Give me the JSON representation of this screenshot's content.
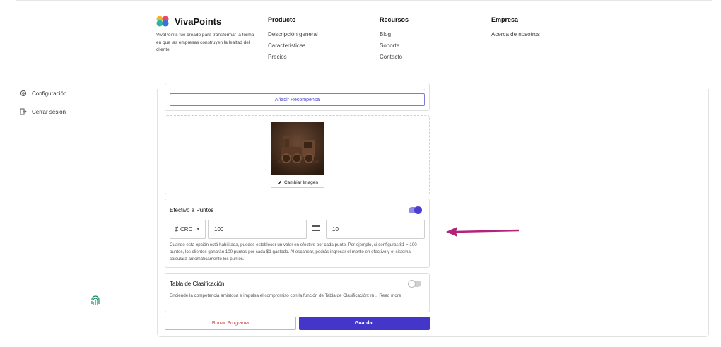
{
  "brand": {
    "name": "VivaPoints",
    "description": "VivaPoints fue creado para transformar la forma en que las empresas construyen la lealtad del cliente."
  },
  "footer_columns": [
    {
      "title": "Producto",
      "links": [
        "Descripción general",
        "Características",
        "Precios"
      ]
    },
    {
      "title": "Recursos",
      "links": [
        "Blog",
        "Soporte",
        "Contacto"
      ]
    },
    {
      "title": "Empresa",
      "links": [
        "Acerca de nosotros"
      ]
    }
  ],
  "sidebar": {
    "items": [
      {
        "label": "Configuración",
        "icon": "gear-icon"
      },
      {
        "label": "Cerrar sesión",
        "icon": "logout-icon"
      }
    ],
    "bottom_icon": "fingerprint-icon"
  },
  "rewards": {
    "add_label": "Añadir Recompensa"
  },
  "image": {
    "change_label": "Cambiar Imagen"
  },
  "cash_to_points": {
    "title": "Efectivo a Puntos",
    "enabled": true,
    "currency": "₡ CRC",
    "cash_value": "100",
    "points_value": "10",
    "help": "Cuando esta opción está habilitada, puedes establecer un valor en efectivo por cada punto. Por ejemplo, si configuras $1 = 100 puntos, los clientes ganarán 100 puntos por cada $1 gastado. Al escanear, podrás ingresar el monto en efectivo y el sistema calculará automáticamente los puntos."
  },
  "leaderboard": {
    "title": "Tabla de Clasificación",
    "enabled": false,
    "description": "Enciende la competencia amistosa e impulsa el compromiso con la función de Tabla de Clasificación: m...",
    "read_more": "Read more"
  },
  "actions": {
    "delete_label": "Borrar Programa",
    "save_label": "Guardar"
  },
  "colors": {
    "accent": "#4336c9",
    "annotation_arrow": "#b3237a",
    "danger": "#c53b3b"
  }
}
